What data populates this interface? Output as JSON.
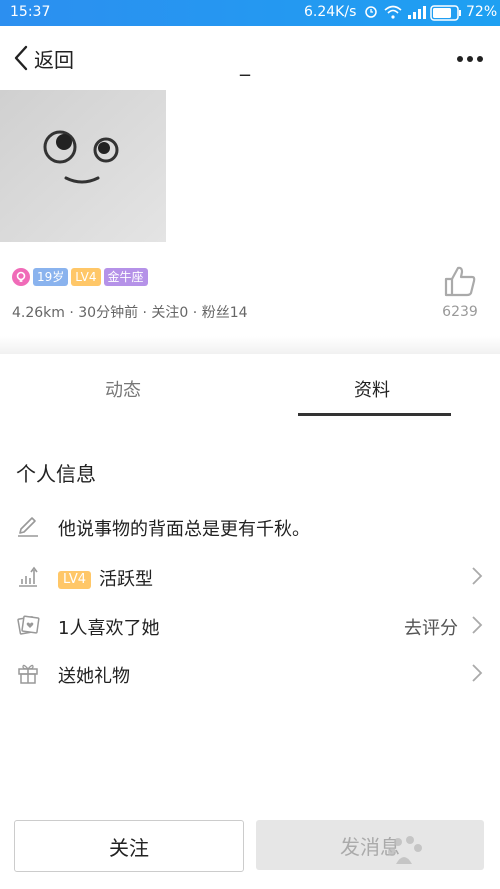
{
  "status_bar": {
    "time": "15:37",
    "network_speed": "6.24K/s",
    "battery": "72%"
  },
  "nav": {
    "back_label": "返回",
    "title": "_"
  },
  "profile": {
    "age": "19岁",
    "level": "LV4",
    "zodiac": "金牛座",
    "meta": "4.26km · 30分钟前 · 关注0 · 粉丝14",
    "likes": "6239"
  },
  "tabs": [
    {
      "label": "动态"
    },
    {
      "label": "资料"
    }
  ],
  "info": {
    "title": "个人信息",
    "bio": "他说事物的背面总是更有千秋。",
    "activity_level": "LV4",
    "activity_label": "活跃型",
    "likes_text": "1人喜欢了她",
    "rate_label": "去评分",
    "gift_label": "送她礼物"
  },
  "footer": {
    "follow_label": "关注",
    "message_label": "发消息"
  },
  "colors": {
    "accent": "#1e9df2",
    "gender": "#f06bb8",
    "age": "#8ab3ee",
    "level": "#ffc768",
    "zodiac": "#b592e8"
  },
  "icons": [
    "alarm-icon",
    "wifi-icon",
    "signal-icon",
    "battery-icon",
    "back-chevron-icon",
    "more-icon",
    "like-icon",
    "edit-icon",
    "activity-chart-icon",
    "photo-heart-icon",
    "gift-icon",
    "chevron-right-icon"
  ]
}
